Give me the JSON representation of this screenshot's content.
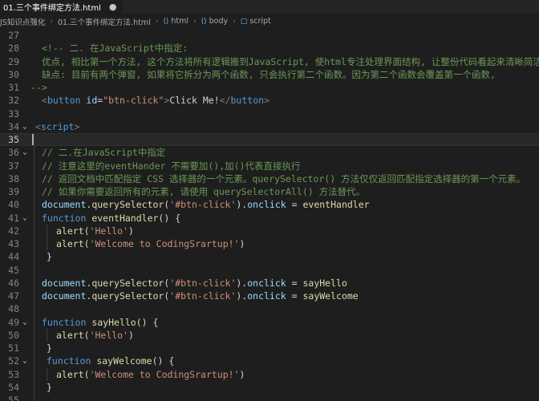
{
  "tab": {
    "label": "01.三个事件绑定方法.html"
  },
  "breadcrumb": {
    "items": [
      "JS知识点强化",
      "01.三个事件绑定方法.html",
      "html",
      "body",
      "script"
    ]
  },
  "editor": {
    "active_line": "35",
    "lines": [
      {
        "n": "27",
        "fold": "",
        "indent": 0,
        "tokens": []
      },
      {
        "n": "28",
        "fold": "",
        "indent": 14,
        "tokens": [
          [
            "tok-comment",
            "<!-- 二. 在JavaScript中指定:"
          ]
        ]
      },
      {
        "n": "29",
        "fold": "",
        "indent": 14,
        "tokens": [
          [
            "tok-comment",
            "优点, 相比第一个方法, 这个方法将所有逻辑搬到JavaScript, 使html专注处理界面结构, 让整份代码看起来清晰简洁"
          ]
        ]
      },
      {
        "n": "30",
        "fold": "",
        "indent": 14,
        "tokens": [
          [
            "tok-comment",
            "缺点: 目前有两个弹窗, 如果将它拆分为两个函数, 只会执行第二个函数。因为第二个函数会覆盖第一个函数,"
          ]
        ]
      },
      {
        "n": "31",
        "fold": "",
        "indent": 0,
        "tokens": [
          [
            "tok-comment",
            "-->"
          ]
        ]
      },
      {
        "n": "32",
        "fold": "",
        "indent": 14,
        "tokens": [
          [
            "tok-punct",
            "<"
          ],
          [
            "tok-tag",
            "button"
          ],
          [
            "tok-plain",
            " "
          ],
          [
            "tok-attr",
            "id"
          ],
          [
            "tok-plain",
            "="
          ],
          [
            "tok-str",
            "\"btn-click\""
          ],
          [
            "tok-punct",
            ">"
          ],
          [
            "tok-plain",
            "Click Me!"
          ],
          [
            "tok-punct",
            "</"
          ],
          [
            "tok-tag",
            "button"
          ],
          [
            "tok-punct",
            ">"
          ]
        ]
      },
      {
        "n": "33",
        "fold": "",
        "indent": 0,
        "tokens": []
      },
      {
        "n": "34",
        "fold": "⌄",
        "indent": 6,
        "tokens": [
          [
            "tok-punct",
            "<"
          ],
          [
            "tok-tag",
            "script"
          ],
          [
            "tok-punct",
            ">"
          ]
        ]
      },
      {
        "n": "35",
        "fold": "",
        "indent": 0,
        "tokens": []
      },
      {
        "n": "36",
        "fold": "⌄",
        "indent": 14,
        "tokens": [
          [
            "tok-comment",
            "// 二.在JavaScript中指定"
          ]
        ]
      },
      {
        "n": "37",
        "fold": "",
        "indent": 14,
        "tokens": [
          [
            "tok-comment",
            "// 注意这里的eventHander 不需要加(),加()代表直接执行"
          ]
        ]
      },
      {
        "n": "38",
        "fold": "",
        "indent": 14,
        "tokens": [
          [
            "tok-comment",
            "// 返回文档中匹配指定 CSS 选择器的一个元素。querySelector() 方法仅仅返回匹配指定选择器的第一个元素。"
          ]
        ]
      },
      {
        "n": "39",
        "fold": "",
        "indent": 14,
        "tokens": [
          [
            "tok-comment",
            "// 如果你需要返回所有的元素, 请使用 querySelectorAll() 方法替代。"
          ]
        ]
      },
      {
        "n": "40",
        "fold": "",
        "indent": 14,
        "tokens": [
          [
            "tok-var",
            "document"
          ],
          [
            "tok-plain",
            "."
          ],
          [
            "tok-fn",
            "querySelector"
          ],
          [
            "tok-plain",
            "("
          ],
          [
            "tok-str",
            "'#btn-click'"
          ],
          [
            "tok-plain",
            ")."
          ],
          [
            "tok-var",
            "onclick"
          ],
          [
            "tok-plain",
            " = "
          ],
          [
            "tok-fn",
            "eventHandler"
          ]
        ]
      },
      {
        "n": "41",
        "fold": "⌄",
        "indent": 14,
        "tokens": [
          [
            "tok-kw",
            "function"
          ],
          [
            "tok-plain",
            " "
          ],
          [
            "tok-fn",
            "eventHandler"
          ],
          [
            "tok-plain",
            "() {"
          ]
        ]
      },
      {
        "n": "42",
        "fold": "",
        "indent": 32,
        "tokens": [
          [
            "tok-fn",
            "alert"
          ],
          [
            "tok-plain",
            "("
          ],
          [
            "tok-str",
            "'Hello'"
          ],
          [
            "tok-plain",
            ")"
          ]
        ]
      },
      {
        "n": "43",
        "fold": "",
        "indent": 32,
        "tokens": [
          [
            "tok-fn",
            "alert"
          ],
          [
            "tok-plain",
            "("
          ],
          [
            "tok-str",
            "'Welcome to CodingSrartup!'"
          ],
          [
            "tok-plain",
            ")"
          ]
        ]
      },
      {
        "n": "44",
        "fold": "",
        "indent": 20,
        "tokens": [
          [
            "tok-plain",
            "}"
          ]
        ]
      },
      {
        "n": "45",
        "fold": "",
        "indent": 0,
        "tokens": []
      },
      {
        "n": "46",
        "fold": "",
        "indent": 14,
        "tokens": [
          [
            "tok-var",
            "document"
          ],
          [
            "tok-plain",
            "."
          ],
          [
            "tok-fn",
            "querySelector"
          ],
          [
            "tok-plain",
            "("
          ],
          [
            "tok-str",
            "'#btn-click'"
          ],
          [
            "tok-plain",
            ")."
          ],
          [
            "tok-var",
            "onclick"
          ],
          [
            "tok-plain",
            " = "
          ],
          [
            "tok-fn",
            "sayHello"
          ]
        ]
      },
      {
        "n": "47",
        "fold": "",
        "indent": 14,
        "tokens": [
          [
            "tok-var",
            "document"
          ],
          [
            "tok-plain",
            "."
          ],
          [
            "tok-fn",
            "querySelector"
          ],
          [
            "tok-plain",
            "("
          ],
          [
            "tok-str",
            "'#btn-click'"
          ],
          [
            "tok-plain",
            ")."
          ],
          [
            "tok-var",
            "onclick"
          ],
          [
            "tok-plain",
            " = "
          ],
          [
            "tok-fn",
            "sayWelcome"
          ]
        ]
      },
      {
        "n": "48",
        "fold": "",
        "indent": 0,
        "tokens": []
      },
      {
        "n": "49",
        "fold": "⌄",
        "indent": 14,
        "tokens": [
          [
            "tok-kw",
            "function"
          ],
          [
            "tok-plain",
            " "
          ],
          [
            "tok-fn",
            "sayHello"
          ],
          [
            "tok-plain",
            "() {"
          ]
        ]
      },
      {
        "n": "50",
        "fold": "",
        "indent": 32,
        "tokens": [
          [
            "tok-fn",
            "alert"
          ],
          [
            "tok-plain",
            "("
          ],
          [
            "tok-str",
            "'Hello'"
          ],
          [
            "tok-plain",
            ")"
          ]
        ]
      },
      {
        "n": "51",
        "fold": "",
        "indent": 20,
        "tokens": [
          [
            "tok-plain",
            "}"
          ]
        ]
      },
      {
        "n": "52",
        "fold": "⌄",
        "indent": 20,
        "tokens": [
          [
            "tok-kw",
            "function"
          ],
          [
            "tok-plain",
            " "
          ],
          [
            "tok-fn",
            "sayWelcome"
          ],
          [
            "tok-plain",
            "() {"
          ]
        ]
      },
      {
        "n": "53",
        "fold": "",
        "indent": 32,
        "tokens": [
          [
            "tok-fn",
            "alert"
          ],
          [
            "tok-plain",
            "("
          ],
          [
            "tok-str",
            "'Welcome to CodingSrartup!'"
          ],
          [
            "tok-plain",
            ")"
          ]
        ]
      },
      {
        "n": "54",
        "fold": "",
        "indent": 20,
        "tokens": [
          [
            "tok-plain",
            "}"
          ]
        ]
      },
      {
        "n": "55",
        "fold": "",
        "indent": 0,
        "tokens": []
      }
    ]
  },
  "icons": {
    "tab_close": "dot-icon",
    "html_tag": "brackets-icon",
    "script_tag": "cube-icon"
  }
}
